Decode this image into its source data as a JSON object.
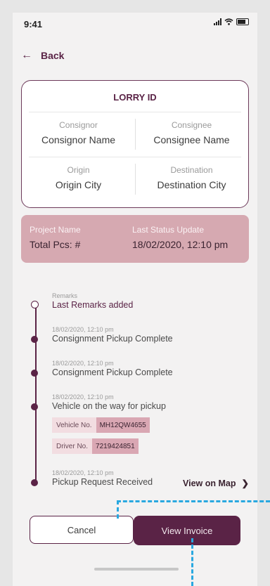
{
  "status_bar": {
    "time": "9:41"
  },
  "nav": {
    "back_label": "Back"
  },
  "lorry_card": {
    "title": "LORRY ID",
    "consignor_label": "Consignor",
    "consignor_value": "Consignor Name",
    "consignee_label": "Consignee",
    "consignee_value": "Consignee Name",
    "origin_label": "Origin",
    "origin_value": "Origin City",
    "destination_label": "Destination",
    "destination_value": "Destination City"
  },
  "project_card": {
    "project_label": "Project Name",
    "total_pcs": "Total Pcs: #",
    "status_label": "Last Status Update",
    "status_value": "18/02/2020, 12:10 pm"
  },
  "timeline": {
    "items": [
      {
        "meta": "Remarks",
        "text": "Last Remarks added"
      },
      {
        "meta": "18/02/2020, 12:10 pm",
        "text": "Consignment Pickup Complete"
      },
      {
        "meta": "18/02/2020, 12:10 pm",
        "text": "Consignment Pickup Complete"
      },
      {
        "meta": "18/02/2020, 12:10 pm",
        "text": "Vehicle on the way for pickup"
      },
      {
        "meta": "18/02/2020, 12:10 pm",
        "text": "Pickup Request Received"
      }
    ],
    "vehicle_label": "Vehicle No.",
    "vehicle_value": "MH12QW4655",
    "driver_label": "Driver No.",
    "driver_value": "7219424851",
    "map_link": "View on Map"
  },
  "actions": {
    "cancel_label": "Cancel",
    "invoice_label": "View Invoice"
  },
  "colors": {
    "accent": "#5a2346",
    "card_pink": "#d6a9b1",
    "chip_value": "#d9a7b3",
    "annotation": "#29a8e0"
  }
}
